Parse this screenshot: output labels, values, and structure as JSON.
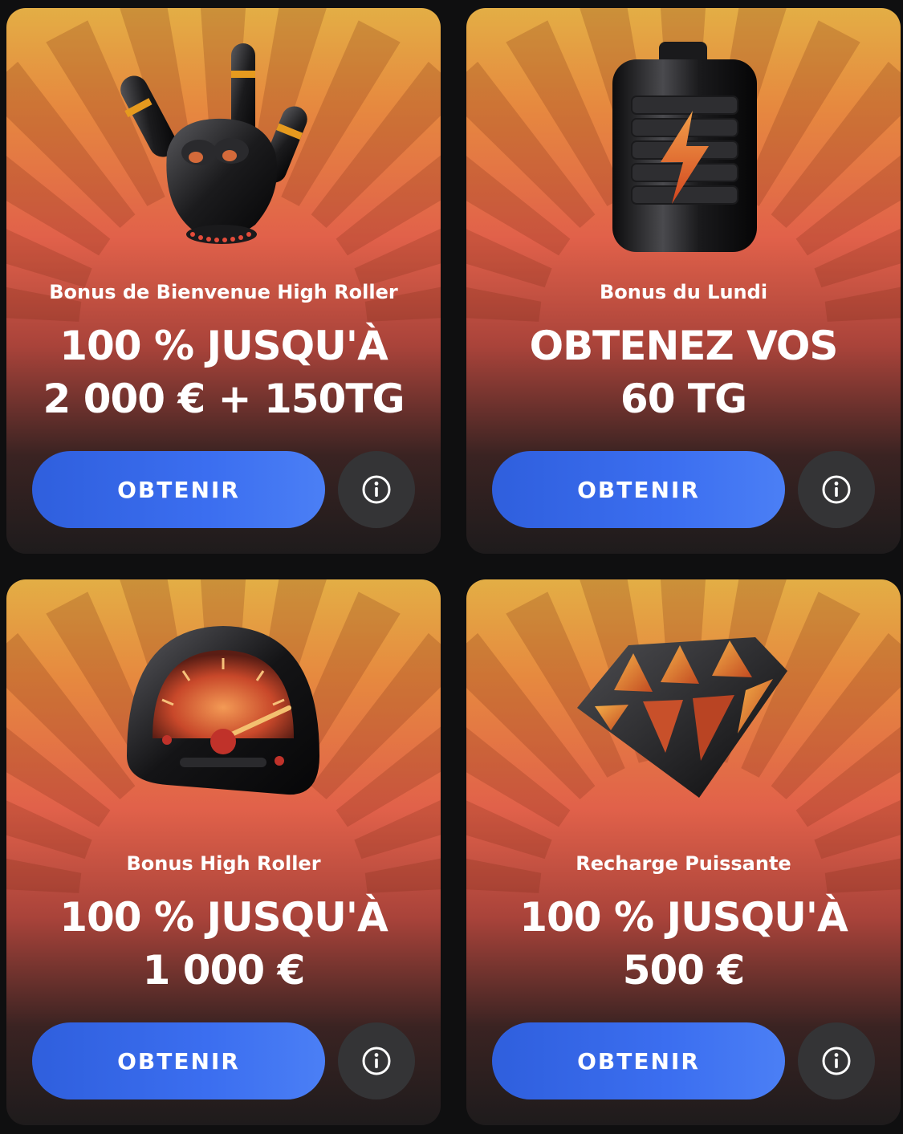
{
  "colors": {
    "page_background": "#0f0f10",
    "button_blue": "#3b6ef0",
    "info_button": "#343436",
    "card_top": "#e3ae45",
    "card_mid": "#e1614a",
    "card_bottom": "#1e1b1c"
  },
  "cards": [
    {
      "subtitle": "Bonus de Bienvenue High Roller",
      "headline": "100 % JUSQU'À\n2 000 € + 150TG",
      "button_label": "OBTENIR",
      "illustration": "rock-hand-glove-icon"
    },
    {
      "subtitle": "Bonus du Lundi",
      "headline": "OBTENEZ VOS\n60 TG",
      "button_label": "OBTENIR",
      "illustration": "battery-icon"
    },
    {
      "subtitle": "Bonus High Roller",
      "headline": "100 % JUSQU'À\n1 000 €",
      "button_label": "OBTENIR",
      "illustration": "speedometer-icon"
    },
    {
      "subtitle": "Recharge Puissante",
      "headline": "100 % JUSQU'À\n500 €",
      "button_label": "OBTENIR",
      "illustration": "diamond-icon"
    }
  ]
}
